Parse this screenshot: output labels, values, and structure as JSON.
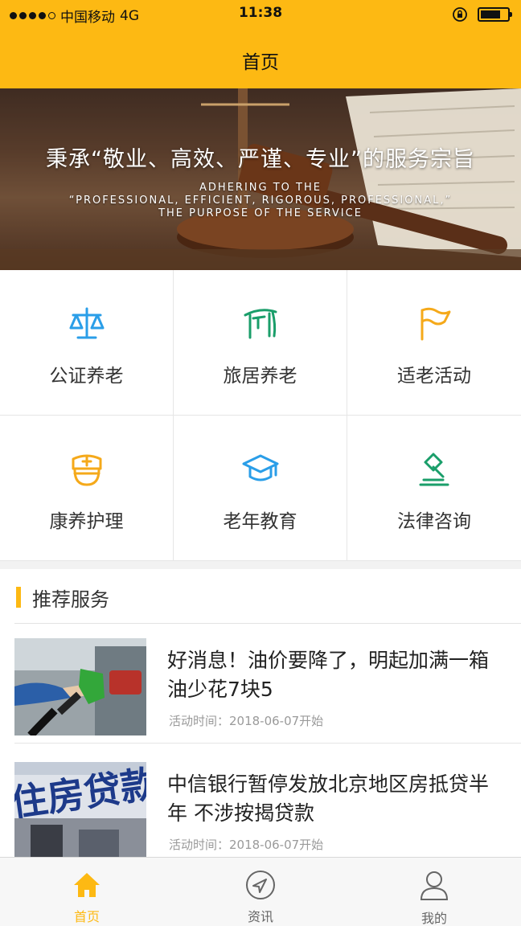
{
  "status_bar": {
    "carrier": "中国移动",
    "network": "4G",
    "time": "11:38"
  },
  "nav": {
    "title": "首页"
  },
  "banner": {
    "headline": "秉承“敬业、高效、严谨、专业”的服务宗旨",
    "en_line1": "ADHERING TO THE",
    "en_line2": "“PROFESSIONAL, EFFICIENT, RIGOROUS, PROFESSIONAL,”",
    "en_line3": "THE PURPOSE OF THE SERVICE"
  },
  "services": [
    {
      "label": "公证养老",
      "icon": "scales-icon",
      "color": "#2a9ee8"
    },
    {
      "label": "旅居养老",
      "icon": "travel-gate-icon",
      "color": "#1a9e6a"
    },
    {
      "label": "适老活动",
      "icon": "flag-icon",
      "color": "#f5a91a"
    },
    {
      "label": "康养护理",
      "icon": "nurse-cap-icon",
      "color": "#f5a91a"
    },
    {
      "label": "老年教育",
      "icon": "graduation-cap-icon",
      "color": "#2a9ee8"
    },
    {
      "label": "法律咨询",
      "icon": "gavel-icon",
      "color": "#1a9e6a"
    }
  ],
  "recommend": {
    "title": "推荐服务",
    "items": [
      {
        "headline": "好消息！油价要降了，明起加满一箱油少花7块5",
        "meta": "活动时间：2018-06-07开始",
        "thumb": "fuel-nozzle-photo"
      },
      {
        "headline": "中信银行暂停发放北京地区房抵贷半年 不涉按揭贷款",
        "meta": "活动时间：2018-06-07开始",
        "thumb": "mortgage-loan-photo",
        "thumb_text": "住房贷款"
      }
    ]
  },
  "tabbar": {
    "tabs": [
      {
        "label": "首页",
        "icon": "home-icon",
        "active": true
      },
      {
        "label": "资讯",
        "icon": "compass-icon",
        "active": false
      },
      {
        "label": "我的",
        "icon": "user-icon",
        "active": false
      }
    ]
  },
  "colors": {
    "accent": "#fdb913",
    "background": "#f2f2f2",
    "text": "#333333",
    "muted": "#9a9a9a"
  }
}
